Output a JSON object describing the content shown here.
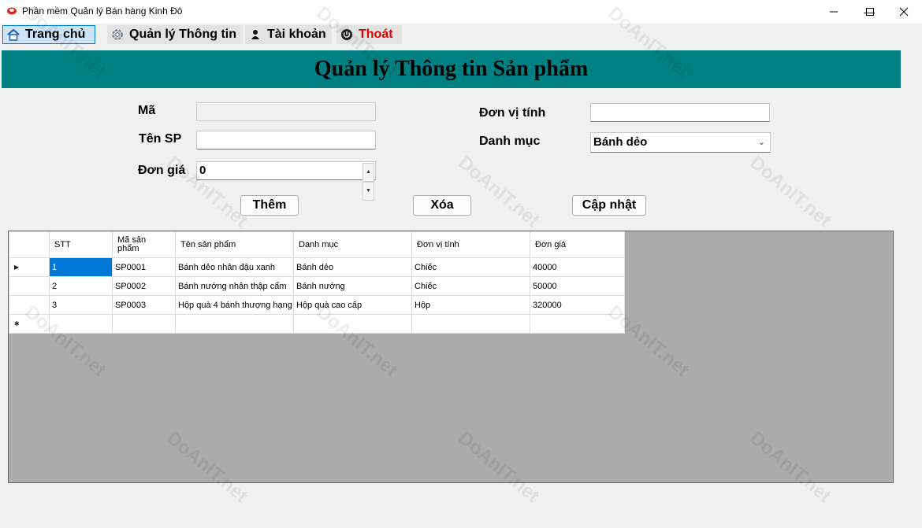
{
  "window": {
    "title": "Phần mềm Quản lý Bán hàng Kinh Đô",
    "minimize_icon": "—",
    "maximize_icon": "☐",
    "close_icon": "✕"
  },
  "menu": [
    {
      "label": "Trang chủ",
      "icon": "home-icon",
      "color": "#000000"
    },
    {
      "label": "Quản lý Thông tin",
      "icon": "gear-icon",
      "color": "#000000"
    },
    {
      "label": "Tài khoản",
      "icon": "user-icon",
      "color": "#000000"
    },
    {
      "label": "Thoát",
      "icon": "power-icon",
      "color": "#e00000"
    }
  ],
  "header": {
    "title": "Quản lý Thông tin Sản phẩm",
    "background": "#008080"
  },
  "form": {
    "ma_label": "Mã",
    "ma_value": "",
    "ten_label": "Tên SP",
    "ten_value": "",
    "gia_label": "Đơn giá",
    "gia_value": "0",
    "dvt_label": "Đơn vị tính",
    "dvt_value": "",
    "danhmuc_label": "Danh mục",
    "danhmuc_value": "Bánh dẻo"
  },
  "buttons": {
    "add": "Thêm",
    "delete": "Xóa",
    "update": "Cập nhật"
  },
  "grid": {
    "columns": [
      "STT",
      "Mã sản phẩm",
      "Tên sản phẩm",
      "Danh mục",
      "Đơn vị tính",
      "Đơn giá"
    ],
    "rows": [
      [
        "1",
        "SP0001",
        "Bánh dẻo nhân đậu xanh",
        "Bánh dẻo",
        "Chiếc",
        "40000"
      ],
      [
        "2",
        "SP0002",
        "Bánh nướng nhân thập cẩm",
        "Bánh nướng",
        "Chiếc",
        "50000"
      ],
      [
        "3",
        "SP0003",
        "Hộp quà 4 bánh thượng hạng",
        "Hộp quà cao cấp",
        "Hộp",
        "320000"
      ]
    ],
    "current_row_marker": "▶",
    "new_row_marker": "✱"
  },
  "watermark": "DoAnIT.net"
}
